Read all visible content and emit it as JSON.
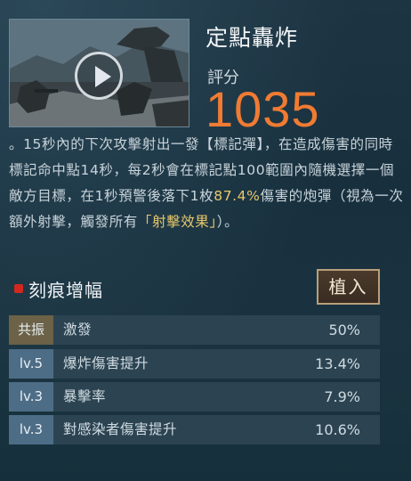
{
  "skill": {
    "title": "定點轟炸",
    "score_label": "評分",
    "score": "1035",
    "description": {
      "p1": "。15秒內的下次攻擊射出一發【標記彈】，在造成傷害的同時標記命中點14秒，每2秒會在標記點100範圍內隨機選擇一個敵方目標，在1秒預警後落下1枚",
      "highlight_pct": "87.4%",
      "p2": "傷害的炮彈（視為一次額外射擊，觸發所有",
      "highlight_effect": "「射擊效果」",
      "p3": "）。"
    }
  },
  "engraving": {
    "section_label": "刻痕增幅",
    "implant_button": "植入",
    "rows": [
      {
        "tag": "共振",
        "name": "激發",
        "value": "50%"
      },
      {
        "tag": "lv.5",
        "name": "爆炸傷害提升",
        "value": "13.4%"
      },
      {
        "tag": "lv.3",
        "name": "暴擊率",
        "value": "7.9%"
      },
      {
        "tag": "lv.3",
        "name": "對感染者傷害提升",
        "value": "10.6%"
      }
    ]
  },
  "colors": {
    "score": "#f07b32",
    "highlight": "#e8c86a",
    "tag_resonance": "#6b6248",
    "tag_level": "#4d6d86",
    "section_marker": "#d2281e"
  },
  "icons": {
    "play": "play-icon"
  }
}
